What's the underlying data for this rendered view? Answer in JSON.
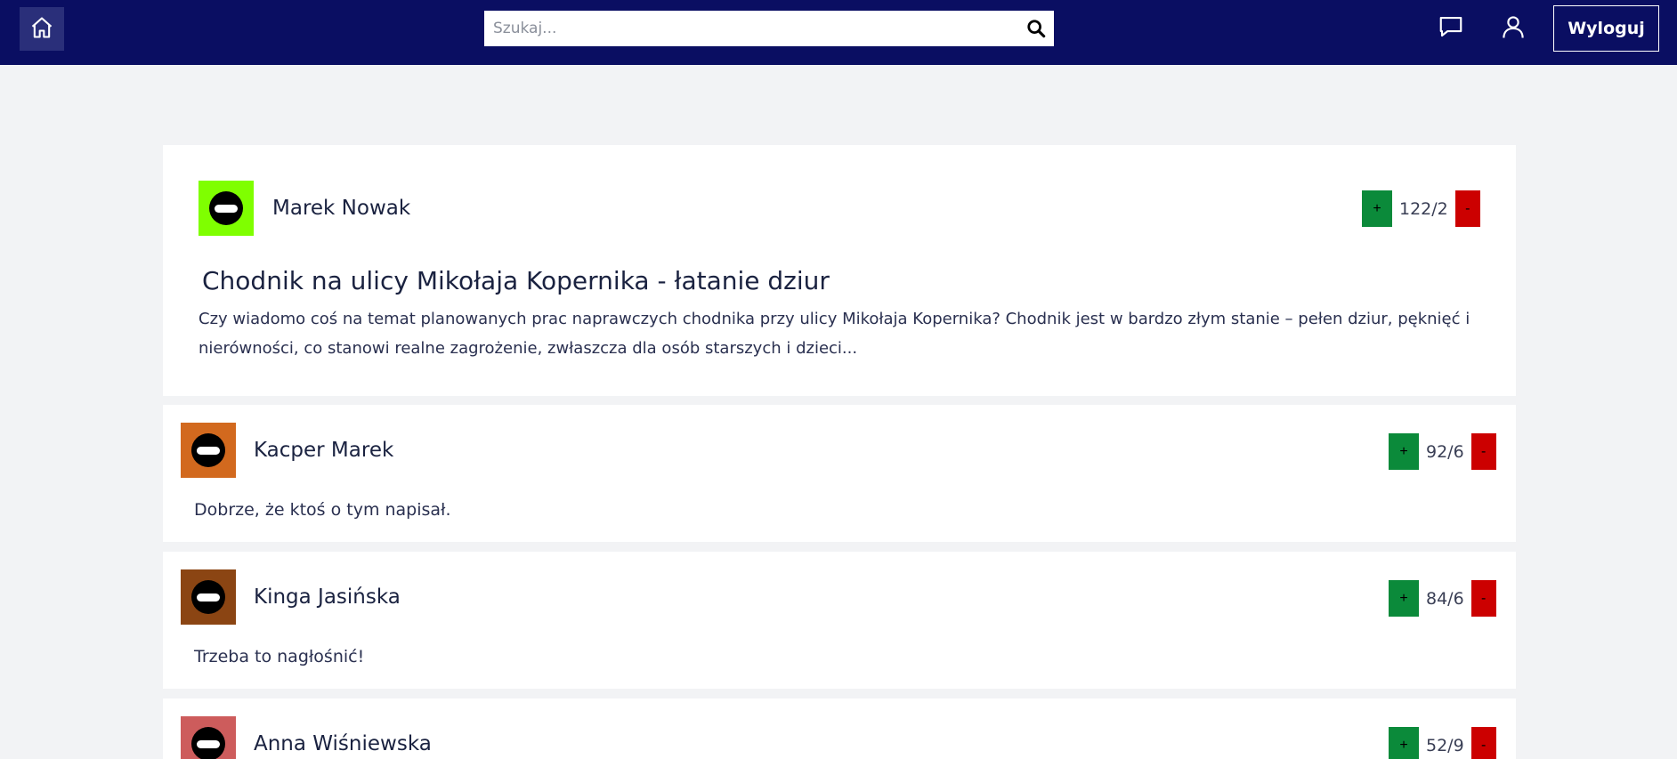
{
  "header": {
    "search_placeholder": "Szukaj...",
    "logout_label": "Wyloguj"
  },
  "post": {
    "author": "Marek Nowak",
    "avatar_color": "#7fff00",
    "score": "122/2",
    "plus_label": "+",
    "minus_label": "-",
    "title": "Chodnik na ulicy Mikołaja Kopernika - łatanie dziur",
    "body": "Czy wiadomo coś na temat planowanych prac naprawczych chodnika przy ulicy Mikołaja Kopernika? Chodnik jest w bardzo złym stanie – pełen dziur, pęknięć i nierówności, co stanowi realne zagrożenie, zwłaszcza dla osób starszych i dzieci..."
  },
  "comments": [
    {
      "author": "Kacper Marek",
      "avatar_color": "#d2691e",
      "score": "92/6",
      "plus_label": "+",
      "minus_label": "-",
      "text": "Dobrze, że ktoś o tym napisał."
    },
    {
      "author": "Kinga Jasińska",
      "avatar_color": "#8b4513",
      "score": "84/6",
      "plus_label": "+",
      "minus_label": "-",
      "text": "Trzeba to nagłośnić!"
    },
    {
      "author": "Anna Wiśniewska",
      "avatar_color": "#cd5c5c",
      "score": "52/9",
      "plus_label": "+",
      "minus_label": "-",
      "text": ""
    }
  ],
  "colors": {
    "header_bg": "#0a0e62",
    "page_bg": "#f2f3f5",
    "upvote": "#0b8a3a",
    "downvote": "#cc0000"
  }
}
